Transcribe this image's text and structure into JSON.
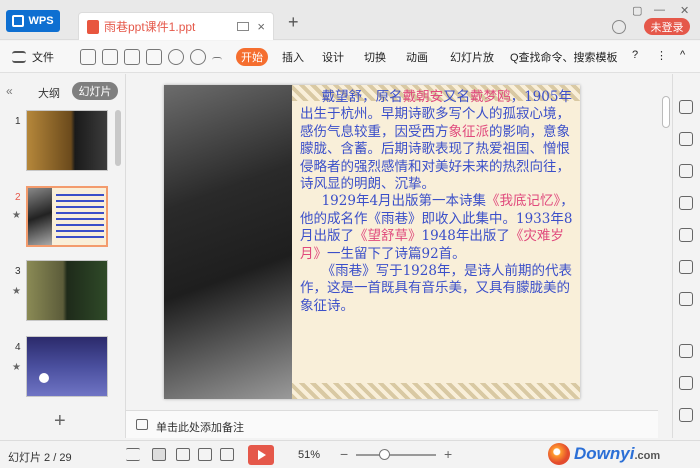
{
  "titlebar": {
    "app_tab": "WPS",
    "doc_tab": "雨巷ppt课件1.ppt",
    "new_tab": "+",
    "close": "×",
    "login": "未登录"
  },
  "menubar": {
    "file": "文件",
    "start": "开始",
    "items": [
      "插入",
      "设计",
      "切换",
      "动画",
      "幻灯片放"
    ],
    "search": "Q查找命令、搜索模板",
    "help": "?",
    "more": "⋮",
    "collapse": "^"
  },
  "sidebar": {
    "collapse": "«",
    "tab_outline": "大纲",
    "tab_slides": "幻灯片",
    "slides": [
      {
        "num": "1",
        "star": false
      },
      {
        "num": "2",
        "star": true
      },
      {
        "num": "3",
        "star": true
      },
      {
        "num": "4",
        "star": true
      }
    ],
    "add": "+"
  },
  "slide": {
    "paragraphs": [
      [
        {
          "t": "戴望舒，原名",
          "c": "b"
        },
        {
          "t": "戴朝安",
          "c": "r"
        },
        {
          "t": "又名",
          "c": "b"
        },
        {
          "t": "戴梦鸥",
          "c": "r"
        },
        {
          "t": "，1905年出生于杭州。早期诗歌多写个人的孤寂心境，感伤气息较重，因受西方",
          "c": "b"
        },
        {
          "t": "象征派",
          "c": "r"
        },
        {
          "t": "的影响，意象朦胧、含蓄。后期诗歌表现了热爱祖国、憎恨侵略者的强烈感情和对美好未来的热烈向往，诗风显的明朗、沉挚。",
          "c": "b"
        }
      ],
      [
        {
          "t": "1929年4月出版第一本诗集",
          "c": "b"
        },
        {
          "t": "《我底记忆》",
          "c": "r"
        },
        {
          "t": "，他的成名作《雨巷》即收入此集中。1933年8月出版了",
          "c": "b"
        },
        {
          "t": "《望舒草》",
          "c": "r"
        },
        {
          "t": "1948年出版了",
          "c": "b"
        },
        {
          "t": "《灾难岁月》",
          "c": "r"
        },
        {
          "t": "一生留下了诗篇92首。",
          "c": "b"
        }
      ],
      [
        {
          "t": "《雨巷》写于1928年，是诗人前期的代表作，这是一首既具有音乐美，又具有朦胧美的象征诗。",
          "c": "b"
        }
      ]
    ]
  },
  "notes": {
    "placeholder": "单击此处添加备注"
  },
  "statusbar": {
    "slide_count": "幻灯片 2 / 29",
    "zoom": "51%",
    "zoom_minus": "−",
    "zoom_plus": "+",
    "zoom_level": 0.35
  },
  "watermark": {
    "text": "Downyi",
    "suffix": ".com"
  }
}
